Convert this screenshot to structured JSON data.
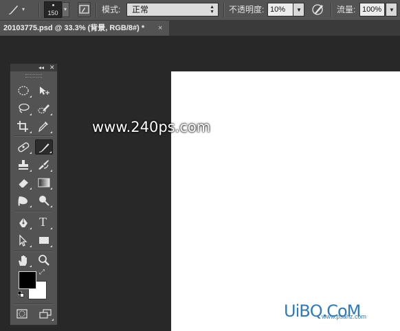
{
  "options_bar": {
    "brush_size": "150",
    "mode_label": "模式:",
    "mode_value": "正常",
    "opacity_label": "不透明度:",
    "opacity_value": "10%",
    "flow_label": "流量:",
    "flow_value": "100%"
  },
  "document_tab": {
    "title": "20103775.psd @ 33.3% (背景, RGB/8#) *",
    "close": "×"
  },
  "toolbox": {
    "collapse": "◂◂",
    "close": "✕",
    "tools": [
      "rectangular-marquee",
      "move",
      "lasso",
      "quick-selection",
      "crop",
      "eyedropper",
      "spot-healing-brush",
      "brush",
      "clone-stamp",
      "history-brush",
      "eraser",
      "gradient",
      "blur",
      "dodge",
      "pen",
      "type",
      "path-selection",
      "rectangle",
      "hand",
      "zoom"
    ],
    "type_tool_glyph": "T",
    "foreground_color": "#000000",
    "background_color": "#ffffff"
  },
  "canvas": {
    "watermark": "www.240ps.com",
    "logo": "UiBQ.CoM",
    "logo_url": "www.psahz.com"
  }
}
